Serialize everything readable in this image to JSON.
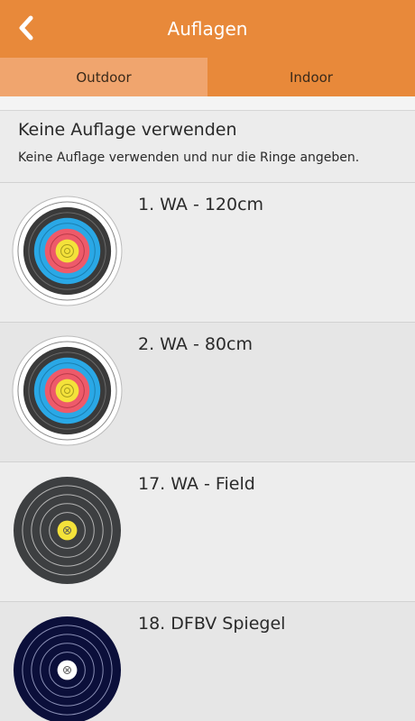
{
  "header": {
    "title": "Auflagen",
    "back_icon": "chevron-left-icon",
    "color": "#e8893a"
  },
  "tabs": [
    {
      "label": "Outdoor",
      "active": true
    },
    {
      "label": "Indoor",
      "active": false
    }
  ],
  "none_option": {
    "title": "Keine Auflage verwenden",
    "subtitle": "Keine Auflage verwenden und nur die Ringe angeben."
  },
  "targets": [
    {
      "label": "1. WA - 120cm",
      "face": "wa-full"
    },
    {
      "label": "2. WA - 80cm",
      "face": "wa-full"
    },
    {
      "label": "17. WA - Field",
      "face": "wa-field"
    },
    {
      "label": "18. DFBV Spiegel",
      "face": "dfbv-spiegel"
    }
  ]
}
